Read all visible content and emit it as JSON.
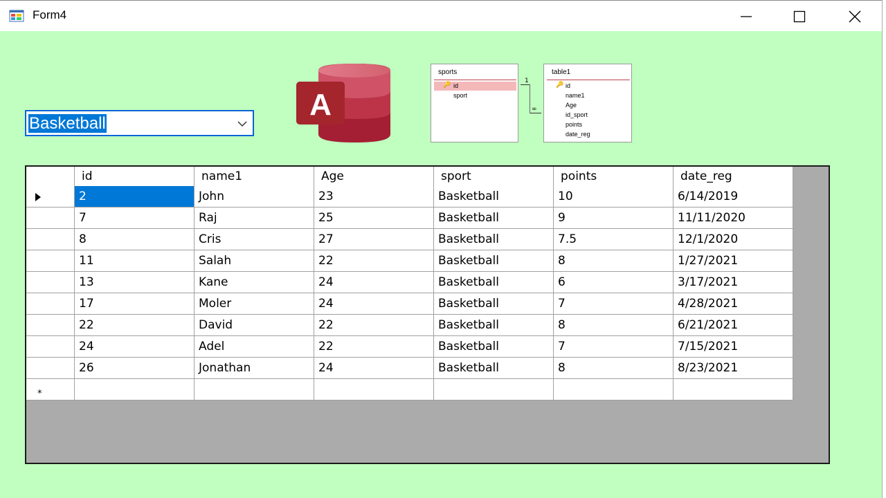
{
  "window": {
    "title": "Form4",
    "minimize_icon": "minimize-icon",
    "maximize_icon": "maximize-icon",
    "close_icon": "close-icon"
  },
  "combo": {
    "selected": "Basketball",
    "arrow_icon": "chevron-down-icon"
  },
  "logo": {
    "letter": "A",
    "icon": "microsoft-access-logo"
  },
  "relationships": {
    "sports": {
      "name": "sports",
      "fields": [
        "id",
        "sport"
      ]
    },
    "table1": {
      "name": "table1",
      "fields": [
        "id",
        "name1",
        "Age",
        "id_sport",
        "points",
        "date_reg"
      ]
    },
    "one_label": "1",
    "many_label": "∞"
  },
  "grid": {
    "columns": [
      "id",
      "name1",
      "Age",
      "sport",
      "points",
      "date_reg"
    ],
    "rows": [
      [
        "2",
        "John",
        "23",
        "Basketball",
        "10",
        "6/14/2019"
      ],
      [
        "7",
        "Raj",
        "25",
        "Basketball",
        "9",
        "11/11/2020"
      ],
      [
        "8",
        "Cris",
        "27",
        "Basketball",
        "7.5",
        "12/1/2020"
      ],
      [
        "11",
        "Salah",
        "22",
        "Basketball",
        "8",
        "1/27/2021"
      ],
      [
        "13",
        "Kane",
        "24",
        "Basketball",
        "6",
        "3/17/2021"
      ],
      [
        "17",
        "Moler",
        "24",
        "Basketball",
        "7",
        "4/28/2021"
      ],
      [
        "22",
        "David",
        "22",
        "Basketball",
        "8",
        "6/21/2021"
      ],
      [
        "24",
        "Adel",
        "22",
        "Basketball",
        "7",
        "7/15/2021"
      ],
      [
        "26",
        "Jonathan",
        "24",
        "Basketball",
        "8",
        "8/23/2021"
      ]
    ],
    "new_row_marker": "*",
    "current_row_icon": "current-row-arrow-icon"
  },
  "colors": {
    "form_background": "#c0ffc0",
    "selection": "#0078d7",
    "grid_background": "#ababab"
  }
}
